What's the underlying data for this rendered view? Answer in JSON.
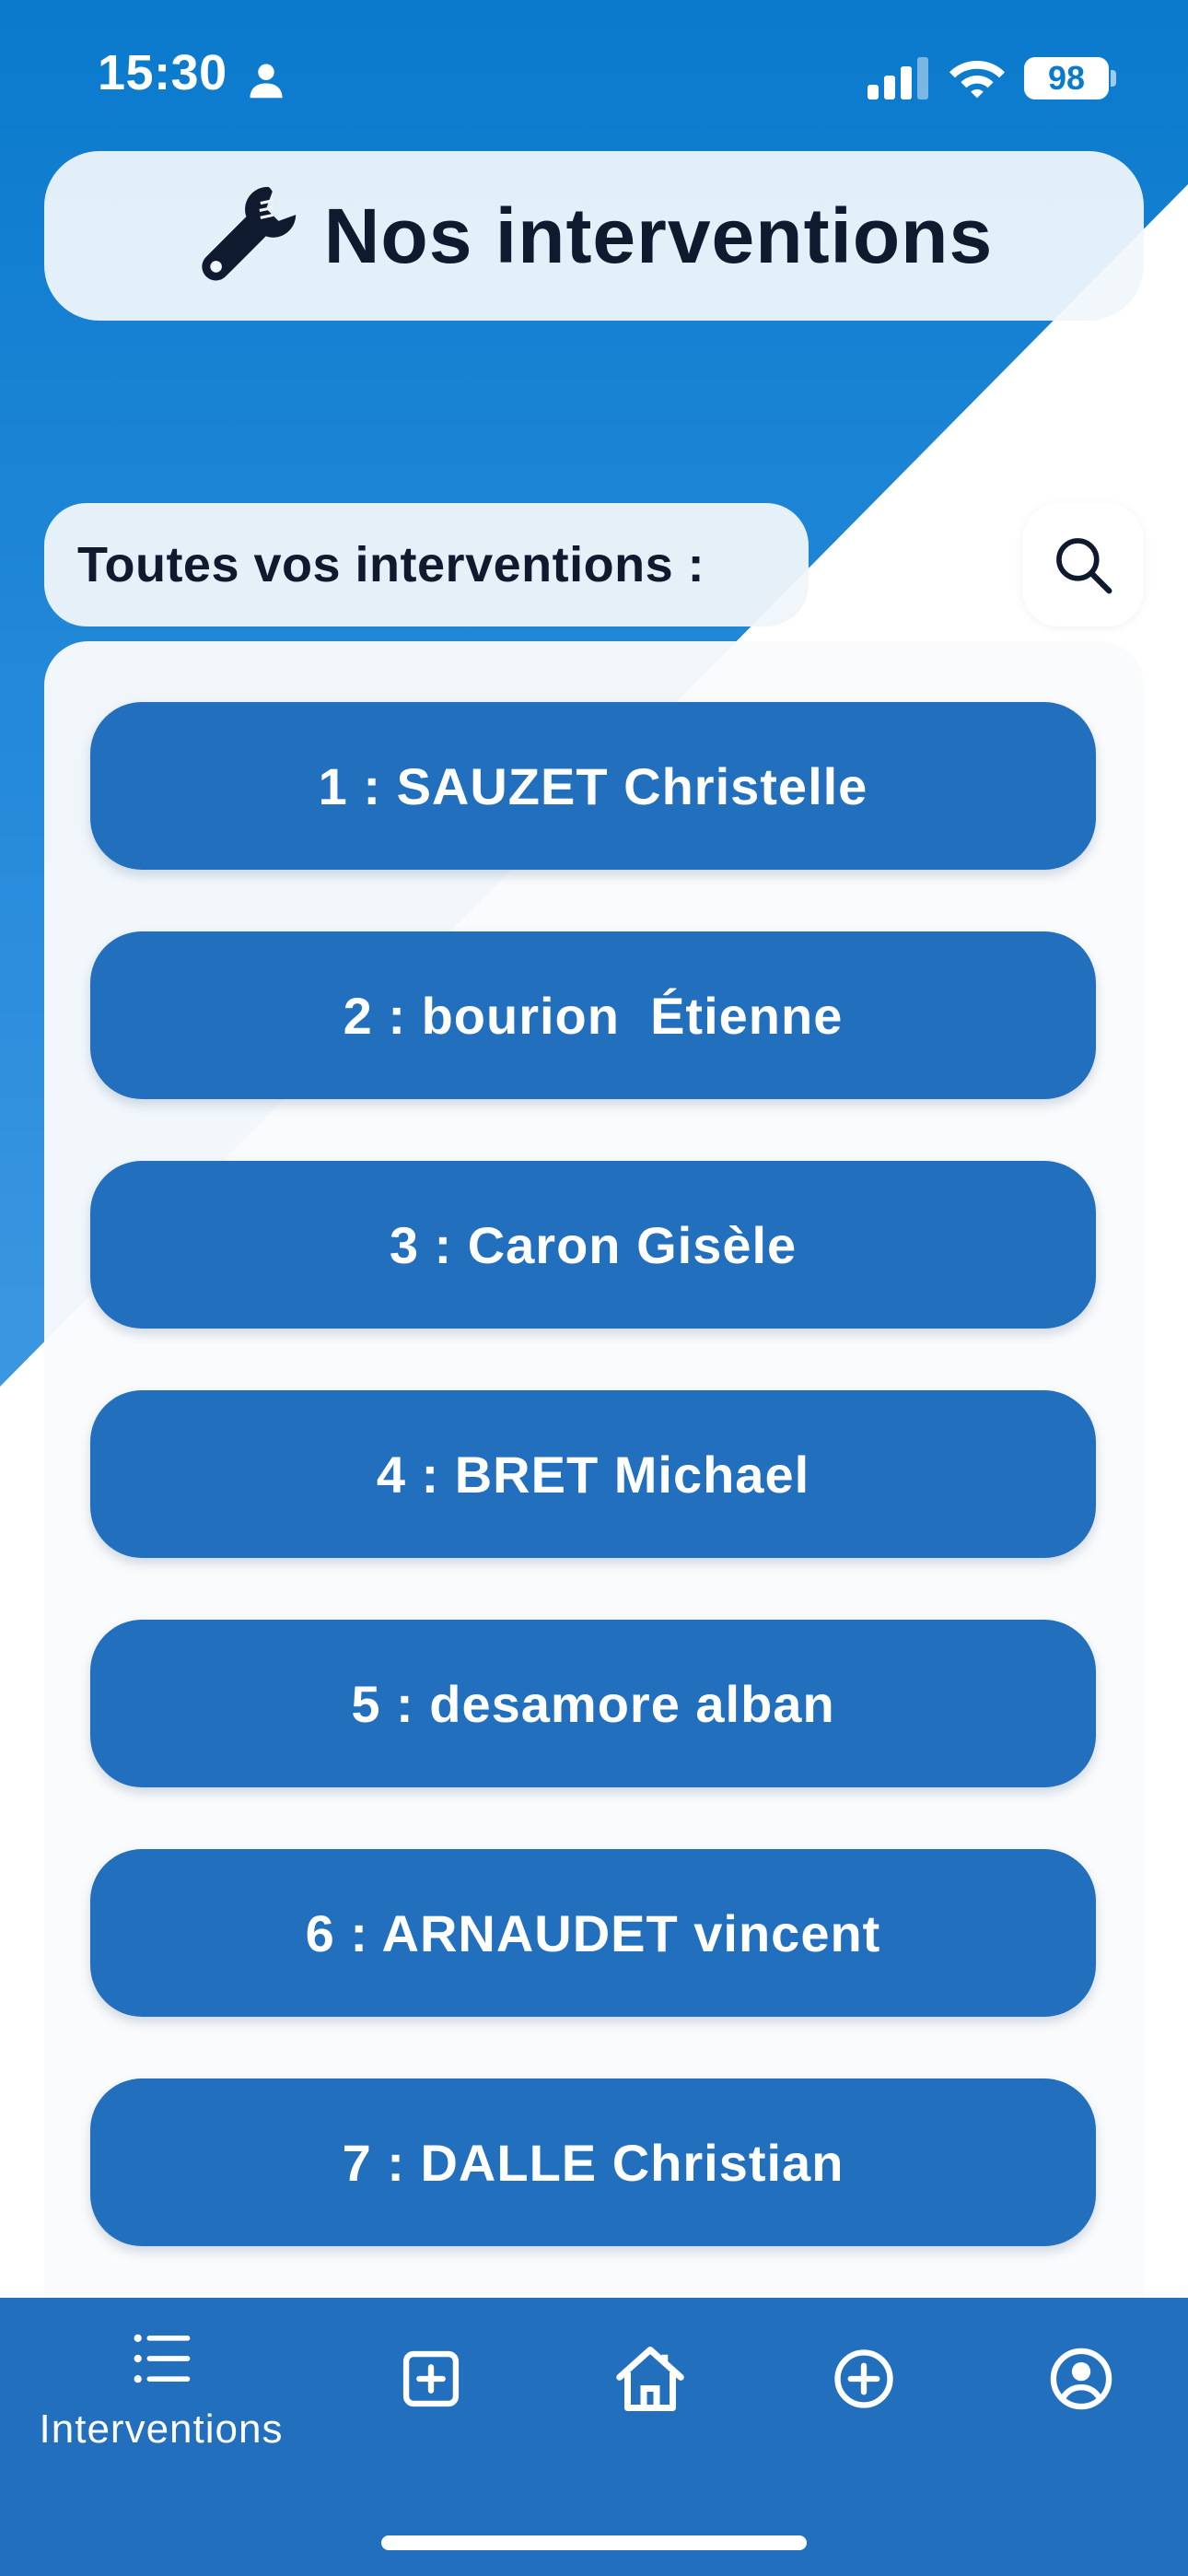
{
  "status_bar": {
    "time": "15:30",
    "battery": "98",
    "icons": [
      "person-icon",
      "signal-icon",
      "wifi-icon",
      "battery-icon"
    ]
  },
  "header": {
    "title": "Nos interventions",
    "icon": "wrench-icon"
  },
  "list": {
    "label": "Toutes vos interventions :",
    "search_icon": "search-icon",
    "items": [
      "1 : SAUZET Christelle",
      "2 : bourion  Étienne",
      "3 : Caron Gisèle",
      "4 : BRET Michael",
      "5 : desamore alban",
      "6 : ARNAUDET vincent",
      "7 : DALLE Christian"
    ]
  },
  "bottom_nav": {
    "items": [
      {
        "icon": "list-icon",
        "label": "Interventions"
      },
      {
        "icon": "add-square-icon",
        "label": ""
      },
      {
        "icon": "home-icon",
        "label": ""
      },
      {
        "icon": "add-circle-icon",
        "label": ""
      },
      {
        "icon": "account-icon",
        "label": ""
      }
    ]
  },
  "colors": {
    "primary_blue": "#226fbd",
    "header_gradient_top": "#0a7acc",
    "card_background": "#f5f8fb",
    "text_dark": "#0f1a2e"
  }
}
